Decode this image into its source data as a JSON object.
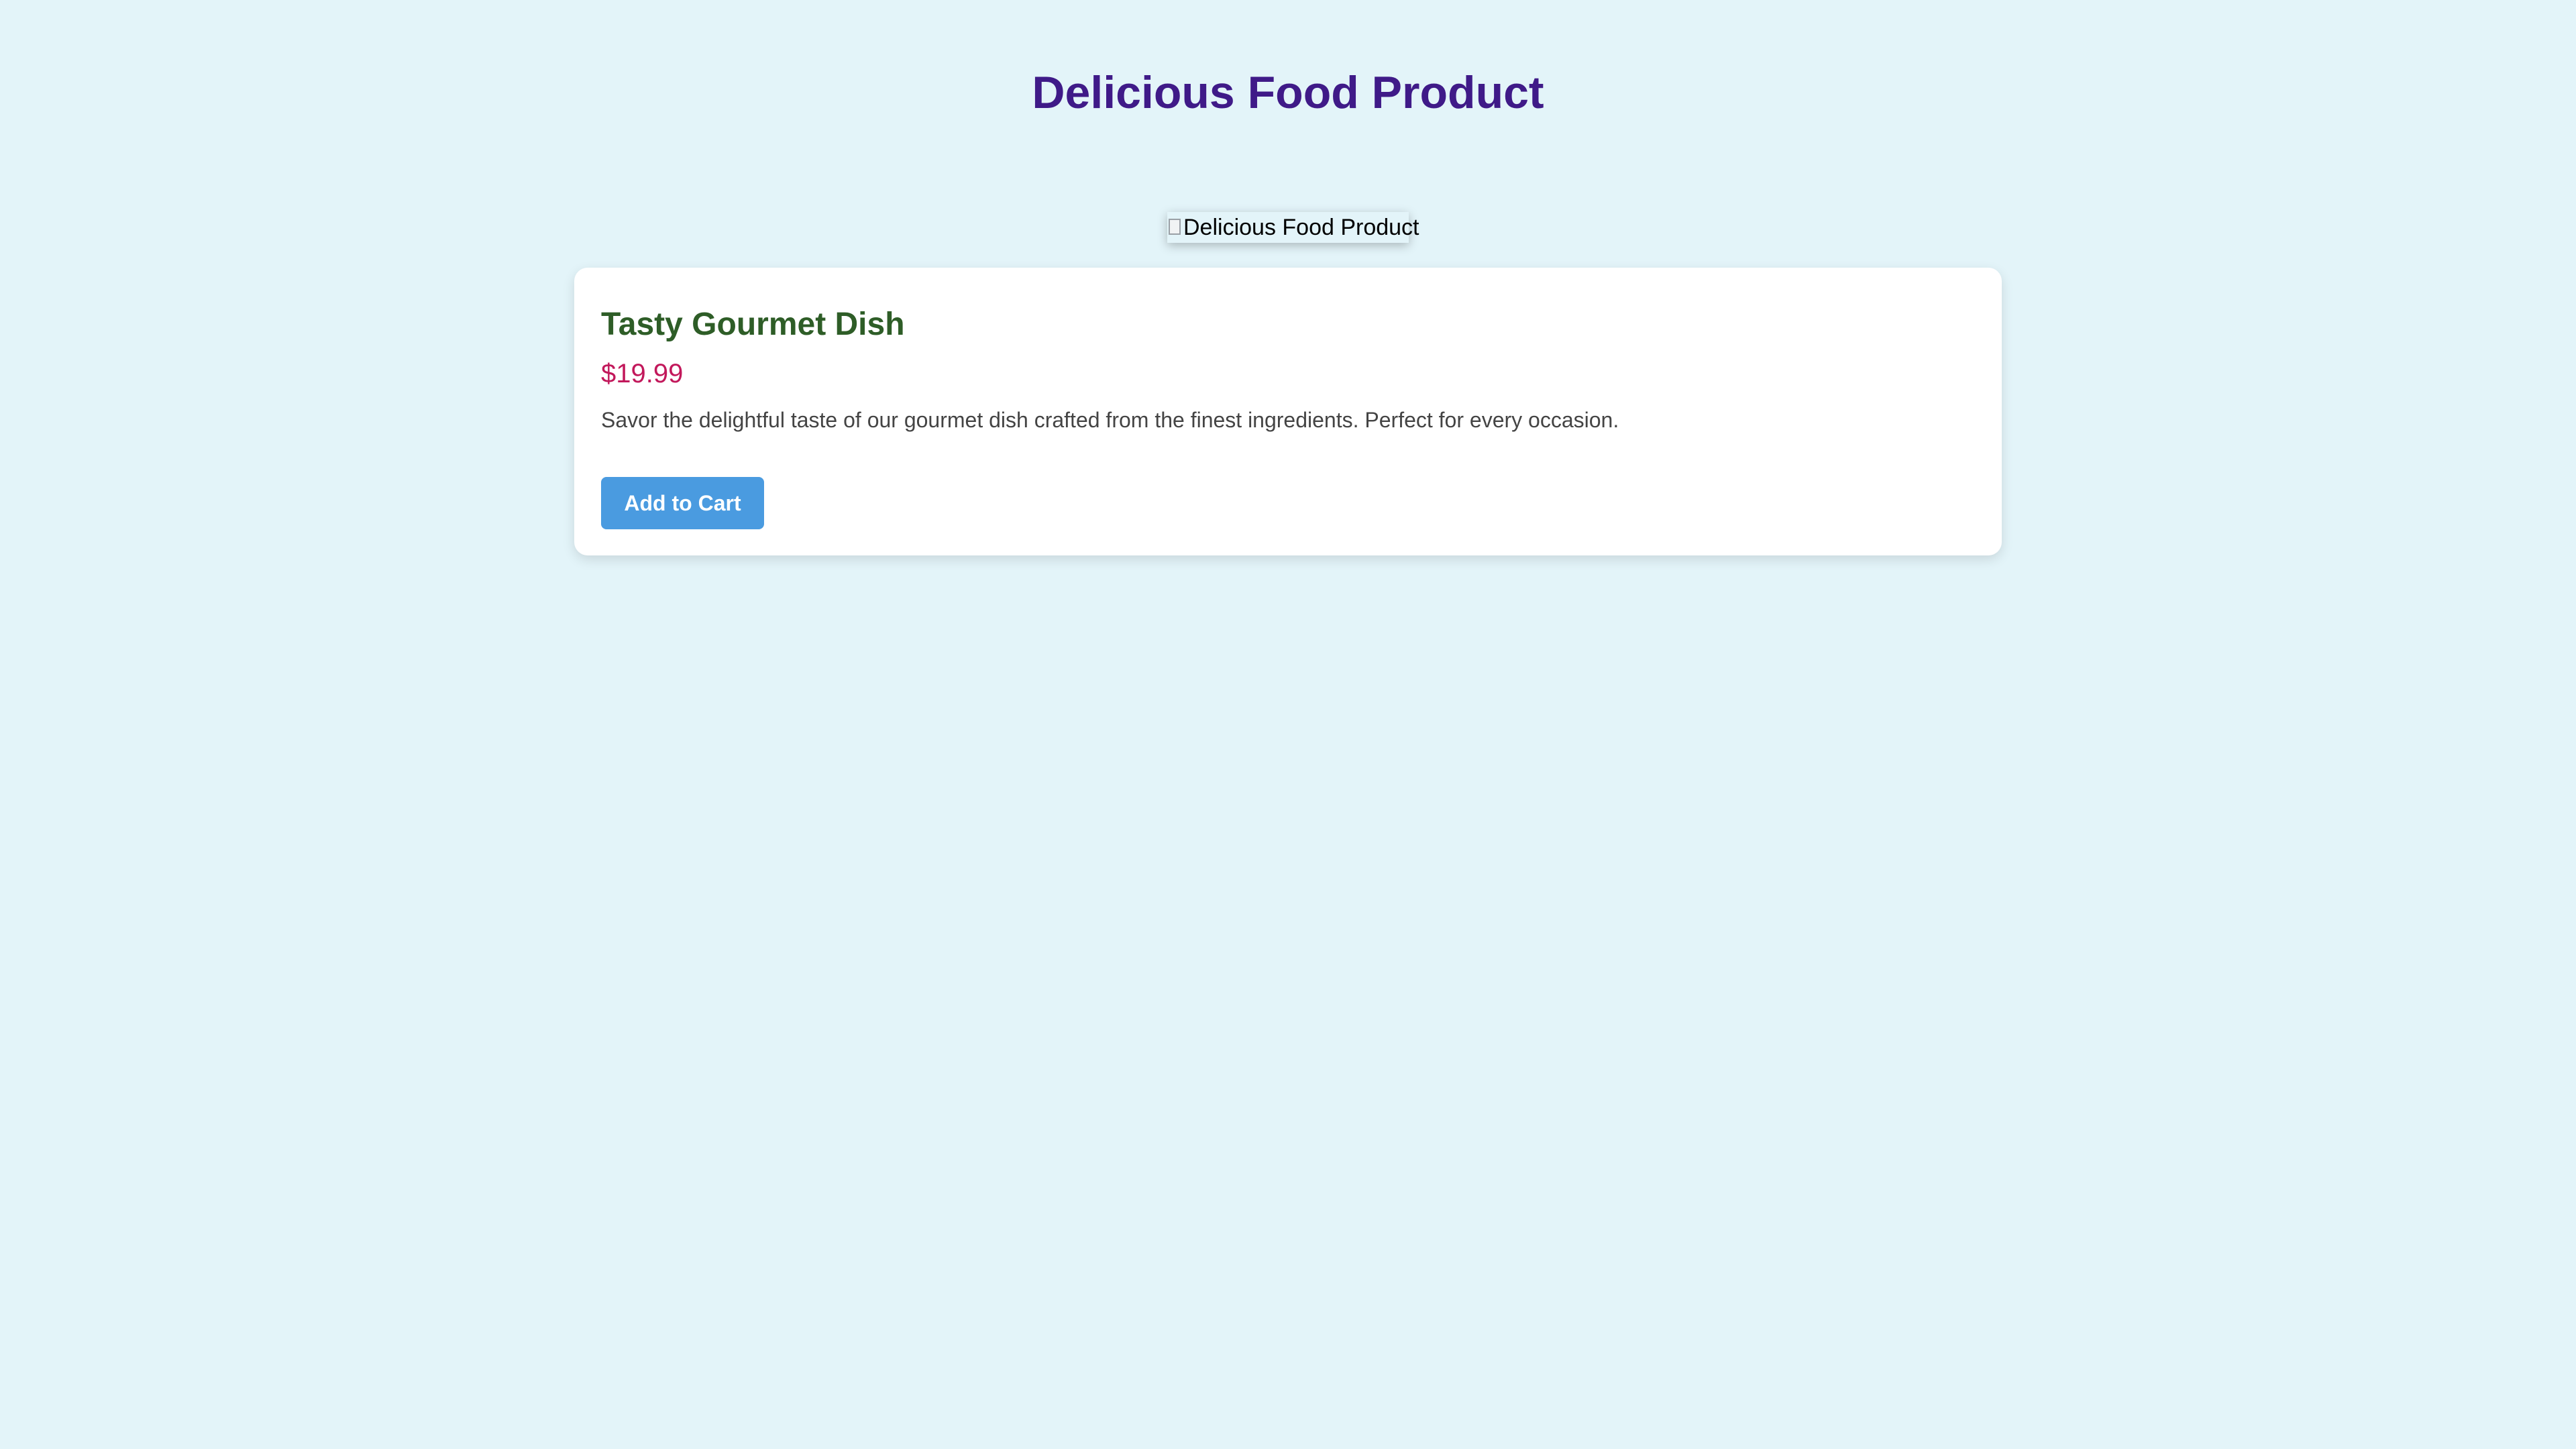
{
  "page": {
    "title": "Delicious Food Product",
    "background_color": "#e3f4f9"
  },
  "product_image": {
    "alt": "Delicious Food Product",
    "icon": "broken-image-icon"
  },
  "product": {
    "name": "Tasty Gourmet Dish",
    "price": "$19.99",
    "description": "Savor the delightful taste of our gourmet dish crafted from the finest ingredients. Perfect for every occasion.",
    "add_to_cart_label": "Add to Cart"
  },
  "colors": {
    "title": "#3f1a88",
    "product_name": "#2e5d27",
    "price": "#c2185b",
    "button": "#4a9be0"
  }
}
